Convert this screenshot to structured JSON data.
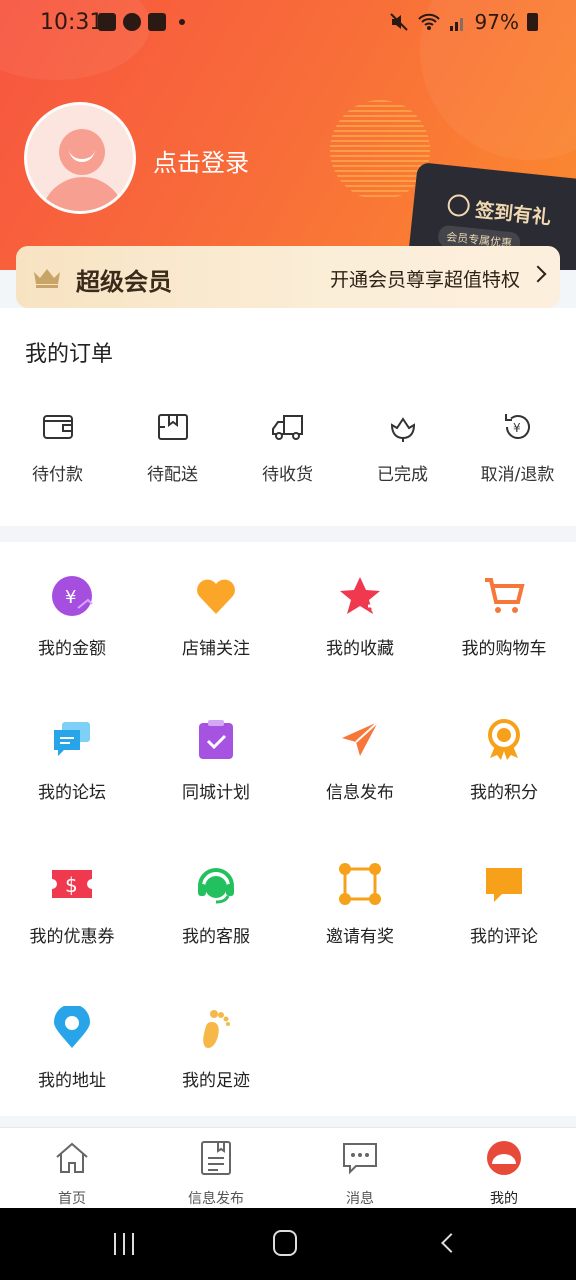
{
  "status_bar": {
    "time": "10:31",
    "battery": "97%"
  },
  "profile": {
    "login_text": "点击登录"
  },
  "signin_card": {
    "title": "签到有礼",
    "subtitle": "会员专属优惠"
  },
  "vip": {
    "title": "超级会员",
    "description": "开通会员尊享超值特权"
  },
  "orders": {
    "title": "我的订单",
    "items": [
      {
        "label": "待付款",
        "icon": "wallet-icon"
      },
      {
        "label": "待配送",
        "icon": "package-icon"
      },
      {
        "label": "待收货",
        "icon": "truck-icon"
      },
      {
        "label": "已完成",
        "icon": "flower-icon"
      },
      {
        "label": "取消/退款",
        "icon": "refund-icon"
      }
    ]
  },
  "grid": {
    "items": [
      {
        "label": "我的金额",
        "icon": "money-icon",
        "color": "#a64ee0"
      },
      {
        "label": "店铺关注",
        "icon": "heart-icon",
        "color": "#fba629"
      },
      {
        "label": "我的收藏",
        "icon": "star-icon",
        "color": "#f0384f"
      },
      {
        "label": "我的购物车",
        "icon": "cart-icon",
        "color": "#f7763a"
      },
      {
        "label": "我的论坛",
        "icon": "chat-icon",
        "color": "#27a5e8"
      },
      {
        "label": "同城计划",
        "icon": "clipboard-icon",
        "color": "#a553e0"
      },
      {
        "label": "信息发布",
        "icon": "send-icon",
        "color": "#f7763a"
      },
      {
        "label": "我的积分",
        "icon": "badge-icon",
        "color": "#f7a11a"
      },
      {
        "label": "我的优惠券",
        "icon": "coupon-icon",
        "color": "#f0384f"
      },
      {
        "label": "我的客服",
        "icon": "headset-icon",
        "color": "#22c15e"
      },
      {
        "label": "邀请有奖",
        "icon": "network-icon",
        "color": "#f7a11a"
      },
      {
        "label": "我的评论",
        "icon": "comment-icon",
        "color": "#f7a11a"
      },
      {
        "label": "我的地址",
        "icon": "location-icon",
        "color": "#27a5e8"
      },
      {
        "label": "我的足迹",
        "icon": "footprint-icon",
        "color": "#f7b84a"
      }
    ]
  },
  "tabbar": {
    "items": [
      {
        "label": "首页",
        "icon": "home-icon"
      },
      {
        "label": "信息发布",
        "icon": "document-icon"
      },
      {
        "label": "消息",
        "icon": "message-icon"
      },
      {
        "label": "我的",
        "icon": "profile-icon"
      }
    ]
  }
}
